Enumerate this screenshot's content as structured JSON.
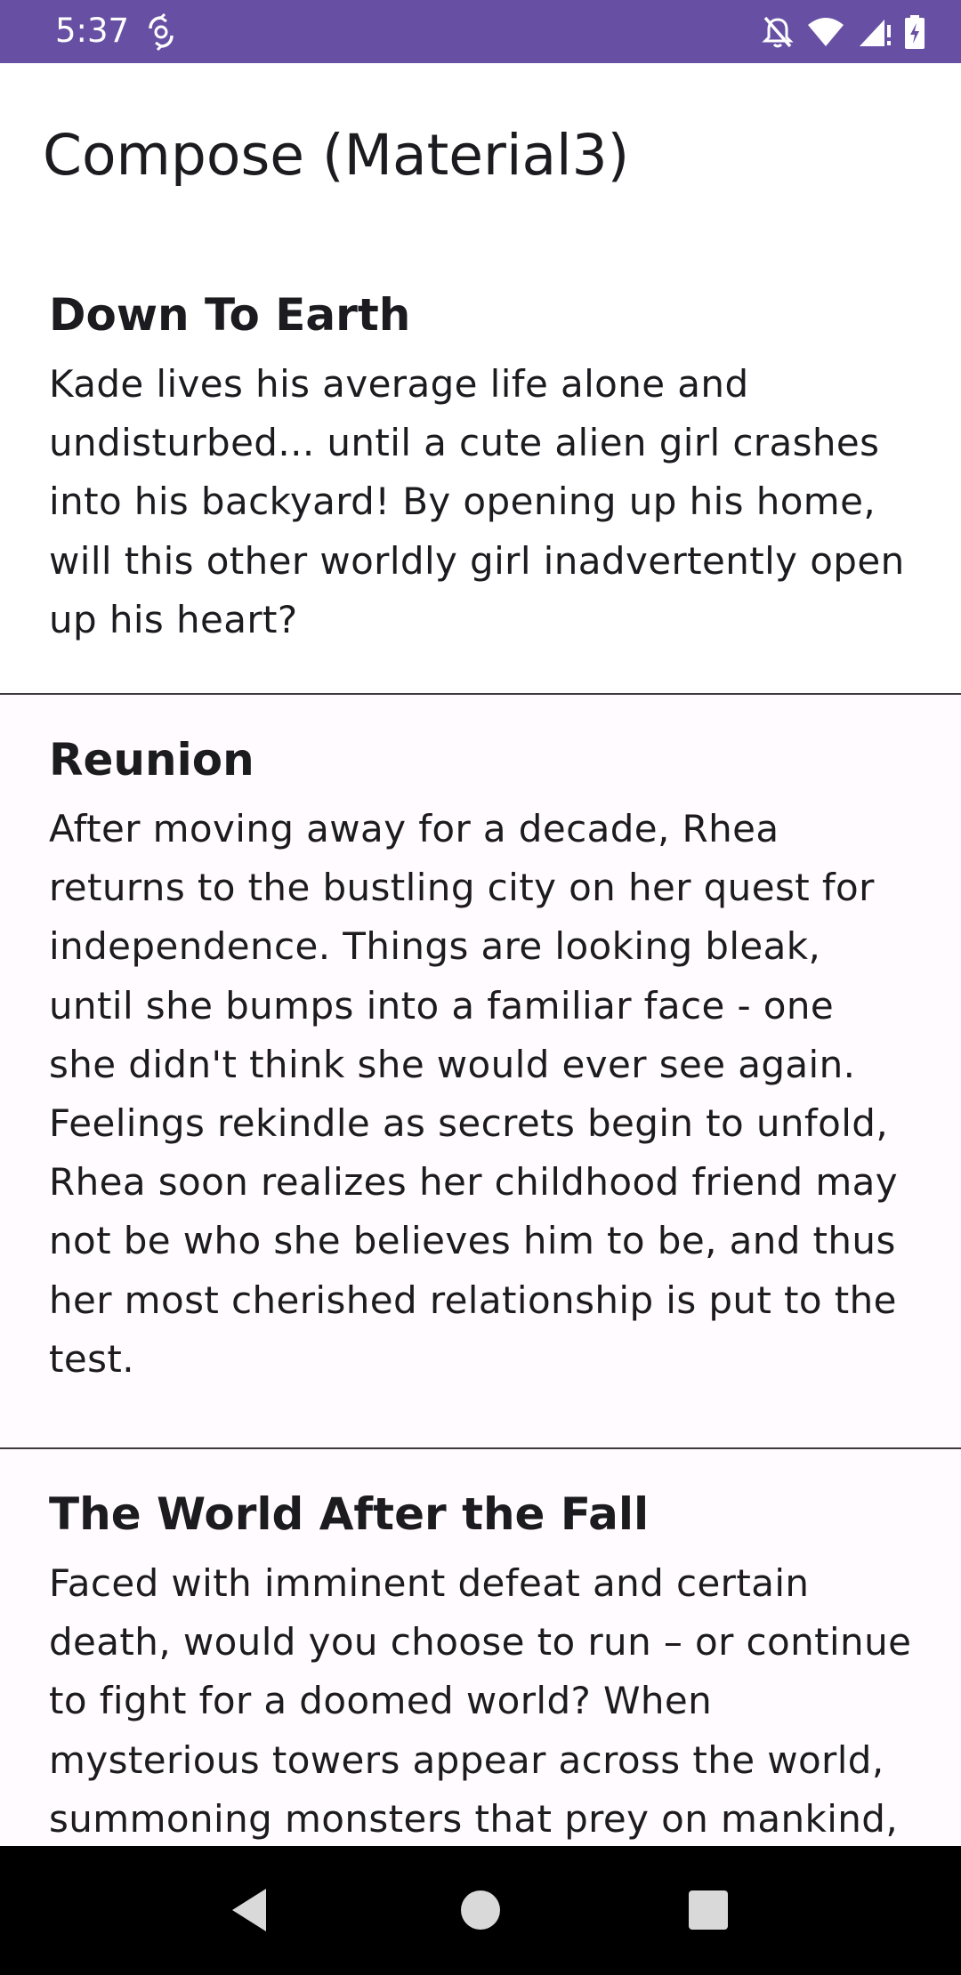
{
  "status_bar": {
    "time": "5:37",
    "icons": [
      "sync-icon",
      "notifications-off-icon",
      "wifi-icon",
      "signal-icon",
      "battery-charging-icon"
    ],
    "color": "#6750a4"
  },
  "app_bar": {
    "title": "Compose (Material3)"
  },
  "stories": [
    {
      "title": "Down To Earth",
      "body": "Kade lives his average life alone and undisturbed... until a cute alien girl crashes into his backyard! By opening up his home, will this other worldly girl inadvertently open up his heart?"
    },
    {
      "title": "Reunion",
      "body": "After moving away for a decade, Rhea returns to the bustling city on her quest for independence. Things are looking bleak, until she bumps into a familiar face - one she didn't think she would ever see again. Feelings rekindle as secrets begin to unfold, Rhea soon realizes her childhood friend may not be who she believes him to be, and thus her most cherished relationship is put to the test."
    },
    {
      "title": "The World After the Fall",
      "body": "Faced with imminent defeat and certain death, would you choose to run – or continue to fight for a doomed world? When mysterious towers appear across the world, summoning monsters that prey on mankind,"
    }
  ],
  "nav_bar": {
    "buttons": [
      "back-icon",
      "home-icon",
      "recents-icon"
    ]
  }
}
